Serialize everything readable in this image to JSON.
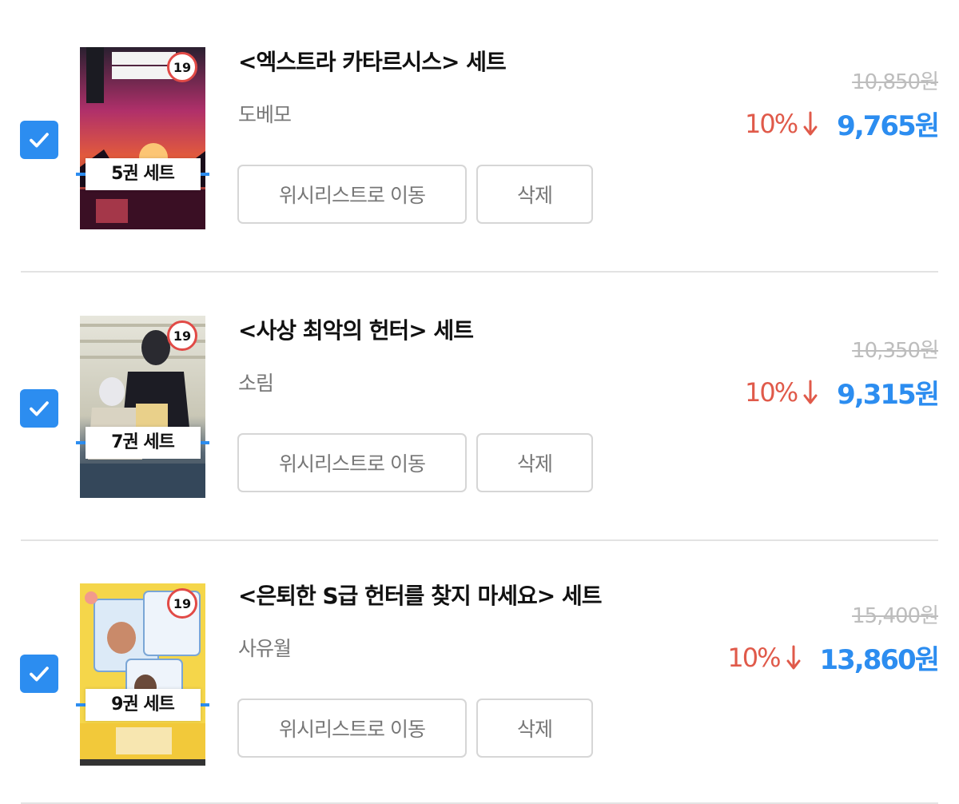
{
  "items": [
    {
      "title": "<엑스트라 카타르시스> 세트",
      "author": "도베모",
      "set_badge": "5권 세트",
      "age_rating": "19",
      "original_price": "10,850원",
      "discount": "10%",
      "sale_price": "9,765원",
      "wishlist_label": "위시리스트로 이동",
      "delete_label": "삭제",
      "checked": true
    },
    {
      "title": "<사상 최악의 헌터> 세트",
      "author": "소림",
      "set_badge": "7권 세트",
      "age_rating": "19",
      "original_price": "10,350원",
      "discount": "10%",
      "sale_price": "9,315원",
      "wishlist_label": "위시리스트로 이동",
      "delete_label": "삭제",
      "checked": true
    },
    {
      "title": "<은퇴한 S급 헌터를 찾지 마세요> 세트",
      "author": "사유월",
      "set_badge": "9권 세트",
      "age_rating": "19",
      "original_price": "15,400원",
      "discount": "10%",
      "sale_price": "13,860원",
      "wishlist_label": "위시리스트로 이동",
      "delete_label": "삭제",
      "checked": true
    }
  ],
  "colors": {
    "accent": "#2c8df0",
    "discount": "#e05a4a",
    "age_badge": "#e14a46"
  },
  "icons": {
    "checkbox": "checkmark-icon",
    "discount": "arrow-down-icon"
  }
}
